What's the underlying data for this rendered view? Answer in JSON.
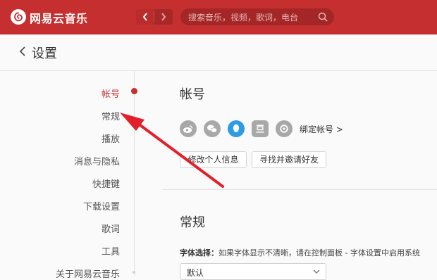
{
  "app": {
    "name": "网易云音乐"
  },
  "search": {
    "placeholder": "搜索音乐，视频，歌词，电台"
  },
  "header": {
    "title": "设置"
  },
  "sidebar": {
    "items": [
      {
        "label": "帐号",
        "active": true
      },
      {
        "label": "常规"
      },
      {
        "label": "播放"
      },
      {
        "label": "消息与隐私"
      },
      {
        "label": "快捷键"
      },
      {
        "label": "下载设置"
      },
      {
        "label": "歌词"
      },
      {
        "label": "工具"
      },
      {
        "label": "关于网易云音乐"
      }
    ]
  },
  "account": {
    "title": "帐号",
    "bind_label": "绑定帐号 >",
    "icons": [
      "weibo-icon",
      "wechat-icon",
      "qq-icon",
      "douban-icon",
      "netease-icon"
    ],
    "edit_button": "修改个人信息",
    "invite_button": "寻找并邀请好友"
  },
  "general": {
    "title": "常规",
    "font_label": "字体选择：",
    "font_hint": "如果字体显示不清晰，请在控制面板 - 字体设置中启用系统",
    "font_value": "默认"
  },
  "colors": {
    "brand": "#c62f2f",
    "qq": "#2e9be5",
    "icon_gray": "#a8a8a8"
  }
}
